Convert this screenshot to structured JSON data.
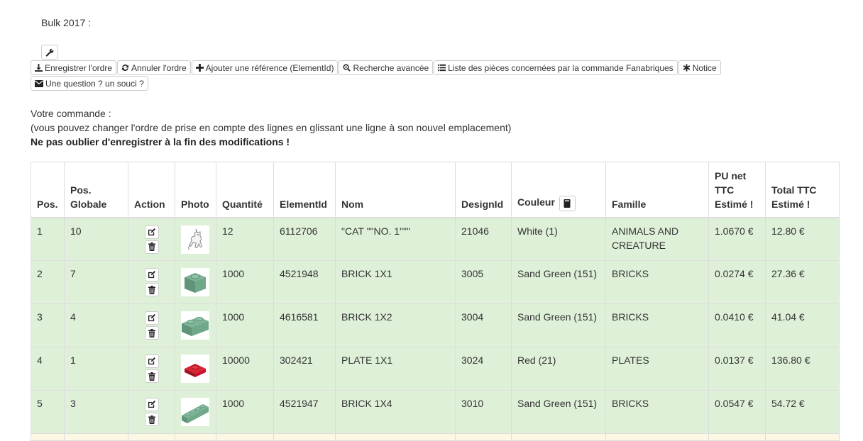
{
  "page": {
    "title": "Bulk 2017 :"
  },
  "toolbar": {
    "buttons": [
      {
        "label": "Enregistrer l'ordre",
        "icon": "download-icon"
      },
      {
        "label": "Annuler l'ordre",
        "icon": "refresh-icon"
      },
      {
        "label": "Ajouter une référence (ElementId)",
        "icon": "plus-icon"
      },
      {
        "label": "Recherche avancée",
        "icon": "zoom-icon"
      },
      {
        "label": "Liste des pièces concernées par la commande Fanabriques",
        "icon": "list-icon"
      },
      {
        "label": "Notice",
        "icon": "asterisk-icon"
      },
      {
        "label": "Une question ? un souci ?",
        "icon": "envelope-icon"
      }
    ]
  },
  "intro": {
    "line1": "Votre commande :",
    "line2": "(vous pouvez changer l'ordre de prise en compte des lignes en glissant une ligne à son nouvel emplacement)",
    "line3": "Ne pas oublier d'enregistrer à la fin des modifications !"
  },
  "table": {
    "headers": {
      "pos": "Pos.",
      "pos_globale": "Pos. Globale",
      "action": "Action",
      "photo": "Photo",
      "quantite": "Quantité",
      "element_id": "ElementId",
      "nom": "Nom",
      "design_id": "DesignId",
      "couleur": "Couleur",
      "famille": "Famille",
      "pu": "PU net TTC Estimé !",
      "total": "Total TTC Estimé !"
    },
    "rows": [
      {
        "pos": "1",
        "pos_globale": "10",
        "quantite": "12",
        "element_id": "6112706",
        "nom": "\"CAT \"\"NO. 1\"\"\"",
        "design_id": "21046",
        "couleur": "White (1)",
        "famille": "ANIMALS AND CREATURE",
        "pu": "1.0670 €",
        "total": "12.80 €",
        "photo": "cat-figure"
      },
      {
        "pos": "2",
        "pos_globale": "7",
        "quantite": "1000",
        "element_id": "4521948",
        "nom": "BRICK 1X1",
        "design_id": "3005",
        "couleur": "Sand Green (151)",
        "famille": "BRICKS",
        "pu": "0.0274 €",
        "total": "27.36 €",
        "photo": "brick-1x1"
      },
      {
        "pos": "3",
        "pos_globale": "4",
        "quantite": "1000",
        "element_id": "4616581",
        "nom": "BRICK 1X2",
        "design_id": "3004",
        "couleur": "Sand Green (151)",
        "famille": "BRICKS",
        "pu": "0.0410 €",
        "total": "41.04 €",
        "photo": "brick-1x2"
      },
      {
        "pos": "4",
        "pos_globale": "1",
        "quantite": "10000",
        "element_id": "302421",
        "nom": "PLATE 1X1",
        "design_id": "3024",
        "couleur": "Red (21)",
        "famille": "PLATES",
        "pu": "0.0137 €",
        "total": "136.80 €",
        "photo": "plate-1x1"
      },
      {
        "pos": "5",
        "pos_globale": "3",
        "quantite": "1000",
        "element_id": "4521947",
        "nom": "BRICK 1X4",
        "design_id": "3010",
        "couleur": "Sand Green (151)",
        "famille": "BRICKS",
        "pu": "0.0547 €",
        "total": "54.72 €",
        "photo": "brick-1x4"
      }
    ]
  },
  "colors": {
    "row_success": "#dff0d8",
    "row_warning": "#fcf8e3",
    "sand_green": "#6fa98a",
    "brick_red": "#c8102e",
    "border": "#dddddd"
  }
}
